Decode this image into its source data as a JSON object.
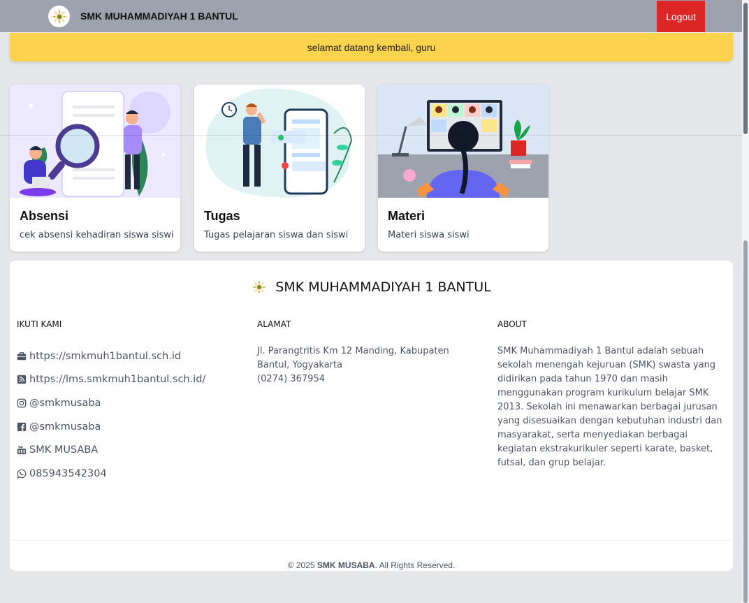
{
  "navbar": {
    "brand_name": "SMK MUHAMMADIYAH 1 BANTUL",
    "logout_label": "Logout"
  },
  "welcome": {
    "message": "selamat datang kembali, guru"
  },
  "cards": [
    {
      "title": "Absensi",
      "description": "cek absensi kehadiran siswa siswi",
      "icon": "attendance-illustration"
    },
    {
      "title": "Tugas",
      "description": "Tugas pelajaran siswa dan siswi",
      "icon": "tasks-illustration"
    },
    {
      "title": "Materi",
      "description": "Materi siswa siswi",
      "icon": "materials-illustration"
    }
  ],
  "footer": {
    "title": "SMK MUHAMMADIYAH 1 BANTUL",
    "follow_heading": "IKUTI KAMI",
    "address_heading": "ALAMAT",
    "about_heading": "ABOUT",
    "social": [
      {
        "icon": "briefcase-icon",
        "label": "https://smkmuh1bantul.sch.id"
      },
      {
        "icon": "rss-icon",
        "label": "https://lms.smkmuh1bantul.sch.id/"
      },
      {
        "icon": "instagram-icon",
        "label": "@smkmusaba"
      },
      {
        "icon": "facebook-icon",
        "label": "@smkmusaba"
      },
      {
        "icon": "youtube-icon",
        "label": "SMK MUSABA"
      },
      {
        "icon": "whatsapp-icon",
        "label": "085943542304"
      }
    ],
    "address_line1": "Jl. Parangtritis Km 12 Manding, Kabupaten Bantul, Yogyakarta",
    "phone": "(0274) 367954",
    "about_text": "SMK Muhammadiyah 1 Bantul adalah sebuah sekolah menengah kejuruan (SMK) swasta yang didirikan pada tahun 1970 dan masih menggunakan program kurikulum belajar SMK 2013. Sekolah ini menawarkan berbagai jurusan yang disesuaikan dengan kebutuhan industri dan masyarakat, serta menyediakan berbagai kegiatan ekstrakurikuler seperti karate, basket, futsal, dan grup belajar.",
    "copyright_prefix": "© 2025 ",
    "copyright_brand": "SMK MUSABA",
    "copyright_suffix": ". All Rights Reserved."
  },
  "colors": {
    "navbar_bg": "#9ca3af",
    "logout_bg": "#dc2626",
    "welcome_bg": "#fcd34d",
    "page_bg": "#e5e7eb"
  }
}
